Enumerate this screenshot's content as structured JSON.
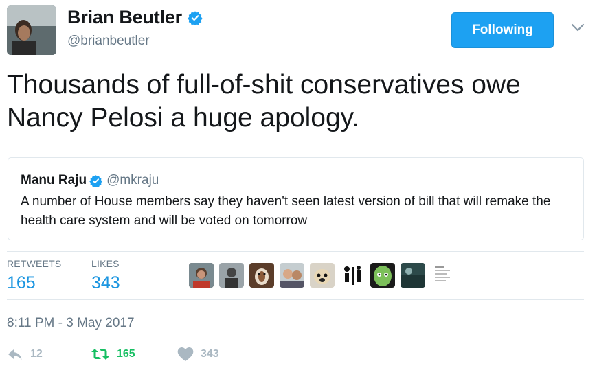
{
  "author": {
    "display_name": "Brian Beutler",
    "handle": "@brianbeutler"
  },
  "follow_button": {
    "label": "Following"
  },
  "tweet": {
    "text": "Thousands of full-of-shit conservatives owe Nancy Pelosi a huge apology."
  },
  "quoted_tweet": {
    "display_name": "Manu Raju",
    "handle": "@mkraju",
    "text": "A number of House members say they haven't seen latest version of bill that will remake the health care system and will be voted on tomorrow"
  },
  "stats": {
    "retweets_label": "RETWEETS",
    "retweets_value": "165",
    "likes_label": "LIKES",
    "likes_value": "343"
  },
  "likers": [
    "liker-1",
    "liker-2",
    "liker-3",
    "liker-4",
    "liker-5",
    "liker-6",
    "liker-7",
    "liker-8",
    "liker-9"
  ],
  "timestamp": "8:11 PM - 3 May 2017",
  "actions": {
    "reply_count": "12",
    "retweet_count": "165",
    "like_count": "343"
  },
  "colors": {
    "brand_blue": "#1da1f2",
    "link_blue": "#1b95e0",
    "retweet_green": "#17bf63",
    "muted_gray": "#657786",
    "icon_gray": "#aab8c2"
  },
  "icons": {
    "verified": "verified-badge-icon",
    "caret": "chevron-down-icon",
    "reply": "reply-icon",
    "retweet": "retweet-icon",
    "like": "heart-icon"
  }
}
